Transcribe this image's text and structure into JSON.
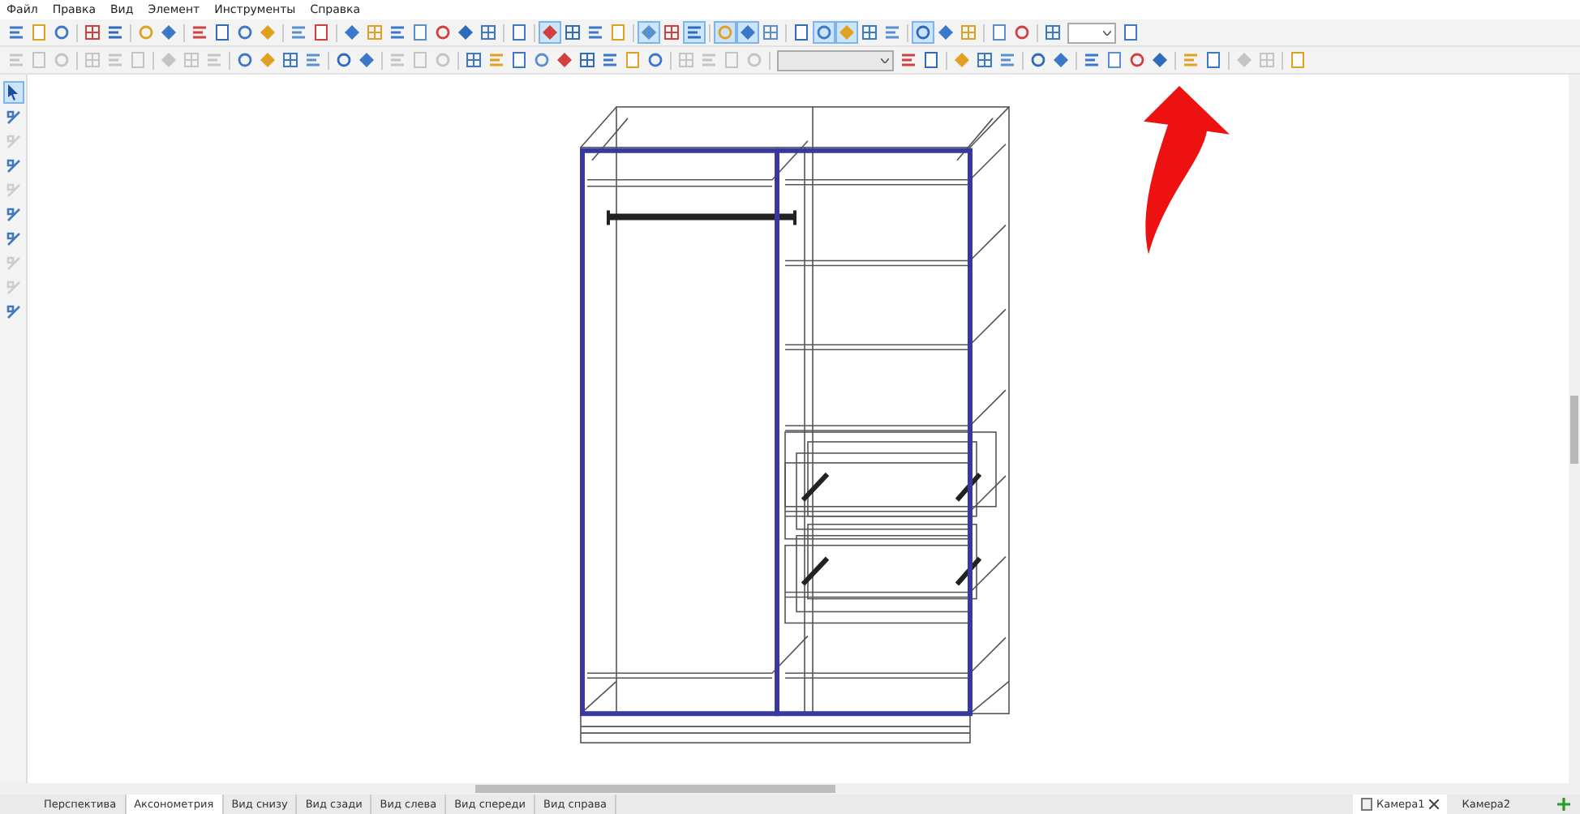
{
  "menu": [
    "Файл",
    "Правка",
    "Вид",
    "Элемент",
    "Инструменты",
    "Справка"
  ],
  "toolbar_1": [
    {
      "kind": "button",
      "pressed": false
    },
    {
      "kind": "button",
      "pressed": false
    },
    {
      "kind": "button",
      "pressed": false
    },
    {
      "kind": "separator"
    },
    {
      "kind": "button",
      "pressed": false
    },
    {
      "kind": "button",
      "pressed": false
    },
    {
      "kind": "separator"
    },
    {
      "kind": "button",
      "pressed": false
    },
    {
      "kind": "button",
      "pressed": false
    },
    {
      "kind": "separator"
    },
    {
      "kind": "button",
      "pressed": false
    },
    {
      "kind": "button",
      "pressed": false
    },
    {
      "kind": "button",
      "pressed": false
    },
    {
      "kind": "button",
      "pressed": false
    },
    {
      "kind": "separator"
    },
    {
      "kind": "button",
      "pressed": false
    },
    {
      "kind": "button",
      "pressed": false
    },
    {
      "kind": "separator"
    },
    {
      "kind": "button",
      "pressed": false
    },
    {
      "kind": "button",
      "pressed": false
    },
    {
      "kind": "button",
      "pressed": false
    },
    {
      "kind": "button",
      "pressed": false
    },
    {
      "kind": "button",
      "pressed": false
    },
    {
      "kind": "button",
      "pressed": false
    },
    {
      "kind": "button",
      "pressed": false
    },
    {
      "kind": "separator"
    },
    {
      "kind": "button",
      "pressed": false
    },
    {
      "kind": "separator"
    },
    {
      "kind": "button",
      "pressed": true
    },
    {
      "kind": "button",
      "pressed": false
    },
    {
      "kind": "button",
      "pressed": false
    },
    {
      "kind": "button",
      "pressed": false
    },
    {
      "kind": "separator"
    },
    {
      "kind": "button",
      "pressed": true
    },
    {
      "kind": "button",
      "pressed": false
    },
    {
      "kind": "button",
      "pressed": true
    },
    {
      "kind": "separator"
    },
    {
      "kind": "button",
      "pressed": true
    },
    {
      "kind": "button",
      "pressed": true
    },
    {
      "kind": "button",
      "pressed": false
    },
    {
      "kind": "separator"
    },
    {
      "kind": "button",
      "pressed": false
    },
    {
      "kind": "button",
      "pressed": true
    },
    {
      "kind": "button",
      "pressed": true
    },
    {
      "kind": "button",
      "pressed": false
    },
    {
      "kind": "button",
      "pressed": false
    },
    {
      "kind": "separator"
    },
    {
      "kind": "button",
      "pressed": true
    },
    {
      "kind": "button",
      "pressed": false
    },
    {
      "kind": "button",
      "pressed": false
    },
    {
      "kind": "separator"
    },
    {
      "kind": "button",
      "pressed": false
    },
    {
      "kind": "button",
      "pressed": false
    },
    {
      "kind": "separator"
    },
    {
      "kind": "button",
      "pressed": false
    },
    {
      "kind": "combo"
    },
    {
      "kind": "button",
      "pressed": false
    }
  ],
  "toolbar_2": [
    {
      "kind": "button",
      "disabled": true
    },
    {
      "kind": "button",
      "disabled": true
    },
    {
      "kind": "button",
      "disabled": true
    },
    {
      "kind": "separator"
    },
    {
      "kind": "button",
      "disabled": true
    },
    {
      "kind": "button",
      "disabled": true
    },
    {
      "kind": "button",
      "disabled": true
    },
    {
      "kind": "separator"
    },
    {
      "kind": "button",
      "disabled": true
    },
    {
      "kind": "button",
      "disabled": true
    },
    {
      "kind": "button",
      "disabled": true
    },
    {
      "kind": "separator"
    },
    {
      "kind": "button",
      "disabled": false
    },
    {
      "kind": "button",
      "disabled": false
    },
    {
      "kind": "button",
      "disabled": false
    },
    {
      "kind": "button",
      "disabled": false
    },
    {
      "kind": "separator"
    },
    {
      "kind": "button",
      "disabled": false
    },
    {
      "kind": "button",
      "disabled": false
    },
    {
      "kind": "separator"
    },
    {
      "kind": "button",
      "disabled": true
    },
    {
      "kind": "button",
      "disabled": true
    },
    {
      "kind": "button",
      "disabled": true
    },
    {
      "kind": "separator"
    },
    {
      "kind": "button",
      "disabled": false
    },
    {
      "kind": "button",
      "disabled": false
    },
    {
      "kind": "button",
      "disabled": false
    },
    {
      "kind": "button",
      "disabled": false
    },
    {
      "kind": "button",
      "disabled": false
    },
    {
      "kind": "button",
      "disabled": false
    },
    {
      "kind": "button",
      "disabled": false
    },
    {
      "kind": "button",
      "disabled": false
    },
    {
      "kind": "button",
      "disabled": false
    },
    {
      "kind": "separator"
    },
    {
      "kind": "button",
      "disabled": true
    },
    {
      "kind": "button",
      "disabled": true
    },
    {
      "kind": "button",
      "disabled": true
    },
    {
      "kind": "button",
      "disabled": true
    },
    {
      "kind": "separator"
    },
    {
      "kind": "combo"
    },
    {
      "kind": "button",
      "disabled": false
    },
    {
      "kind": "button",
      "disabled": false
    },
    {
      "kind": "separator"
    },
    {
      "kind": "button",
      "disabled": false
    },
    {
      "kind": "button",
      "disabled": false
    },
    {
      "kind": "button",
      "disabled": false
    },
    {
      "kind": "separator"
    },
    {
      "kind": "button",
      "disabled": false
    },
    {
      "kind": "button",
      "disabled": false
    },
    {
      "kind": "separator"
    },
    {
      "kind": "button",
      "disabled": false
    },
    {
      "kind": "button",
      "disabled": false
    },
    {
      "kind": "button",
      "disabled": false
    },
    {
      "kind": "button",
      "disabled": false
    },
    {
      "kind": "separator"
    },
    {
      "kind": "button",
      "disabled": false
    },
    {
      "kind": "button",
      "disabled": false
    },
    {
      "kind": "separator"
    },
    {
      "kind": "button",
      "disabled": true
    },
    {
      "kind": "button",
      "disabled": true
    },
    {
      "kind": "separator"
    },
    {
      "kind": "button",
      "disabled": false
    }
  ],
  "left_toolbar": [
    {
      "pressed": true,
      "disabled": false
    },
    {
      "pressed": false,
      "disabled": false
    },
    {
      "pressed": false,
      "disabled": true
    },
    {
      "pressed": false,
      "disabled": false
    },
    {
      "pressed": false,
      "disabled": true
    },
    {
      "pressed": false,
      "disabled": false
    },
    {
      "pressed": false,
      "disabled": false
    },
    {
      "pressed": false,
      "disabled": true
    },
    {
      "pressed": false,
      "disabled": true
    },
    {
      "pressed": false,
      "disabled": false
    }
  ],
  "view_tabs": [
    {
      "label": "Перспектива",
      "selected": false
    },
    {
      "label": "Аксонометрия",
      "selected": true
    },
    {
      "label": "Вид снизу",
      "selected": false
    },
    {
      "label": "Вид сзади",
      "selected": false
    },
    {
      "label": "Вид слева",
      "selected": false
    },
    {
      "label": "Вид спереди",
      "selected": false
    },
    {
      "label": "Вид справа",
      "selected": false
    }
  ],
  "camera_tabs": [
    {
      "label": "Камера1",
      "selected": true
    },
    {
      "label": "Камера2",
      "selected": false
    }
  ]
}
